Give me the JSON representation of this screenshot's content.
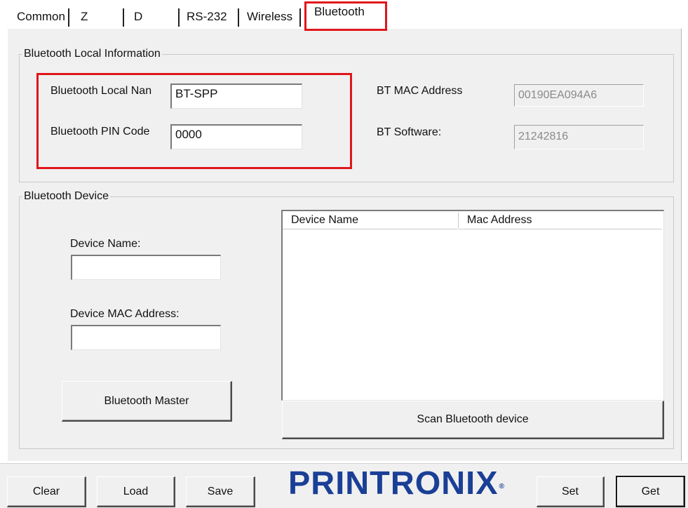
{
  "tabs": [
    {
      "label": "Common",
      "active": false
    },
    {
      "label": "Z",
      "active": false
    },
    {
      "label": "D",
      "active": false
    },
    {
      "label": "RS-232",
      "active": false
    },
    {
      "label": "Wireless",
      "active": false
    },
    {
      "label": "Bluetooth",
      "active": true
    }
  ],
  "local_info": {
    "title": "Bluetooth Local Information",
    "local_name_label": "Bluetooth Local Nan",
    "local_name_value": "BT-SPP",
    "pin_label": "Bluetooth PIN Code",
    "pin_value": "0000",
    "mac_label": "BT MAC Address",
    "mac_value": "00190EA094A6",
    "software_label": "BT Software:",
    "software_value": "21242816"
  },
  "device": {
    "title": "Bluetooth Device",
    "name_label": "Device Name:",
    "name_value": "",
    "mac_label": "Device MAC Address:",
    "mac_value": "",
    "master_button": "Bluetooth Master",
    "list_columns": [
      "Device Name",
      "Mac Address"
    ],
    "scan_button": "Scan Bluetooth device"
  },
  "bottom": {
    "clear": "Clear",
    "load": "Load",
    "save": "Save",
    "set": "Set",
    "get": "Get",
    "logo": "PRINTRONIX"
  },
  "colors": {
    "highlight": "#e0161b",
    "logo": "#1a3f96",
    "panel": "#f0f0f0"
  },
  "icons": {
    "logo_mark": "registered-trademark"
  }
}
